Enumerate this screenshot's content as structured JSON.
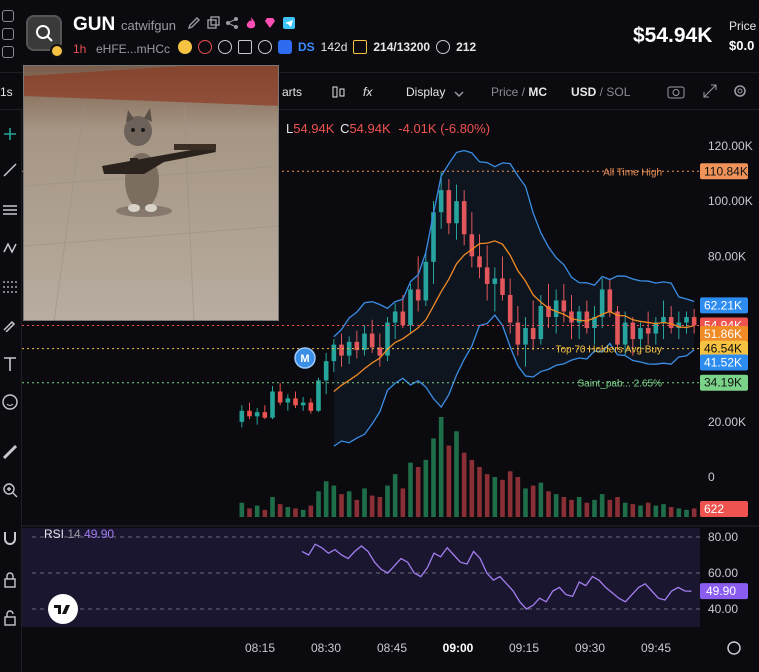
{
  "header": {
    "token_symbol": "GUN",
    "token_name": "catwifgun",
    "timeframe": "1h",
    "address": "eHFE...mHCc",
    "ds_label": "DS",
    "ds_age": "142d",
    "holders": "214/13200",
    "views": "212",
    "price": "$54.94K",
    "price_label": "Price",
    "price_sub": "$0.0"
  },
  "toolbar": {
    "charts_label": "arts",
    "display_label": "Display",
    "price_mc_price": "Price",
    "price_mc_sep": " / ",
    "price_mc_mc": "MC",
    "usd": "USD",
    "usd_sep": " / ",
    "sol": "SOL",
    "fx_label": "fx"
  },
  "ohlc": {
    "l_label": "L",
    "l_value": "54.94K",
    "c_label": "C",
    "c_value": "54.94K",
    "change": "-4.01K (-6.80%)"
  },
  "colors": {
    "up": "#26a69a",
    "down": "#ef5350",
    "bollinger": "#3a8ee6",
    "ma": "#f08a24",
    "rsi": "#a27ef0",
    "ath": "#f0935a",
    "top_holders": "#f5c242",
    "saint": "#7bd389"
  },
  "chart_data": {
    "type": "candlestick",
    "x_ticks": [
      "08:15",
      "08:30",
      "08:45",
      "09:00",
      "09:15",
      "09:30",
      "09:45"
    ],
    "y_ticks": [
      "120.00K",
      "100.00K",
      "80.00K",
      "20.00K",
      "0"
    ],
    "y_ticks_hidden_positions": [
      120000,
      100000,
      80000,
      20000,
      0
    ],
    "ylim": [
      0,
      130000
    ],
    "price_labels": [
      {
        "text": "110.84K",
        "value": 110840,
        "bg": "#f0935a",
        "fg": "#111"
      },
      {
        "text": "62.21K",
        "value": 62210,
        "bg": "#2d8cf0",
        "fg": "#fff"
      },
      {
        "text": "54.94K",
        "value": 54940,
        "bg": "#ef5350",
        "fg": "#fff"
      },
      {
        "text": "51.86K",
        "value": 51860,
        "bg": "#f08a24",
        "fg": "#fff"
      },
      {
        "text": "46.54K",
        "value": 46540,
        "bg": "#f5c242",
        "fg": "#111"
      },
      {
        "text": "41.52K",
        "value": 41520,
        "bg": "#2d8cf0",
        "fg": "#fff"
      },
      {
        "text": "34.19K",
        "value": 34190,
        "bg": "#7bd389",
        "fg": "#111"
      },
      {
        "text": "622",
        "value": 0,
        "bg": "#ef5350",
        "fg": "#fff"
      }
    ],
    "annotations": [
      {
        "text": "All Time High",
        "value": 110840
      },
      {
        "text": "Top 70 Holders Avg Buy",
        "value": 46540
      },
      {
        "text": "Saint_pab... 2.65%",
        "value": 34190
      }
    ],
    "marker_label": "M",
    "candles": [
      [
        20000,
        26000,
        18000,
        24000
      ],
      [
        24000,
        27000,
        21000,
        22000
      ],
      [
        22000,
        25000,
        19000,
        23500
      ],
      [
        23500,
        26000,
        21000,
        21500
      ],
      [
        21500,
        33000,
        21000,
        31000
      ],
      [
        31000,
        34000,
        26000,
        27000
      ],
      [
        27000,
        30000,
        24000,
        28500
      ],
      [
        28500,
        31000,
        25000,
        26000
      ],
      [
        26000,
        29000,
        24000,
        27000
      ],
      [
        27000,
        28500,
        23000,
        24000
      ],
      [
        24000,
        36000,
        23500,
        35000
      ],
      [
        35000,
        45000,
        30000,
        42000
      ],
      [
        42000,
        50000,
        38000,
        48000
      ],
      [
        48000,
        52000,
        40000,
        44000
      ],
      [
        44000,
        51000,
        41000,
        49000
      ],
      [
        49000,
        53000,
        43000,
        46000
      ],
      [
        46000,
        55000,
        44000,
        52000
      ],
      [
        52000,
        57000,
        45000,
        47000
      ],
      [
        47000,
        52000,
        40000,
        44000
      ],
      [
        44000,
        58000,
        42000,
        56000
      ],
      [
        56000,
        63000,
        50000,
        60000
      ],
      [
        60000,
        66000,
        54000,
        55000
      ],
      [
        55000,
        70000,
        52000,
        68000
      ],
      [
        68000,
        80000,
        60000,
        64000
      ],
      [
        64000,
        82000,
        62000,
        78000
      ],
      [
        78000,
        100000,
        70000,
        96000
      ],
      [
        96000,
        110800,
        90000,
        104000
      ],
      [
        104000,
        108000,
        88000,
        92000
      ],
      [
        92000,
        106000,
        86000,
        100000
      ],
      [
        100000,
        104000,
        84000,
        88000
      ],
      [
        88000,
        96000,
        76000,
        80000
      ],
      [
        80000,
        88000,
        72000,
        76000
      ],
      [
        76000,
        84000,
        64000,
        70000
      ],
      [
        70000,
        76000,
        60000,
        72000
      ],
      [
        72000,
        80000,
        64000,
        66000
      ],
      [
        66000,
        72000,
        52000,
        56000
      ],
      [
        56000,
        62000,
        44000,
        48000
      ],
      [
        48000,
        58000,
        40000,
        54000
      ],
      [
        54000,
        64000,
        46000,
        50000
      ],
      [
        50000,
        66000,
        48000,
        62000
      ],
      [
        62000,
        70000,
        54000,
        58000
      ],
      [
        58000,
        68000,
        52000,
        64000
      ],
      [
        64000,
        70000,
        56000,
        60000
      ],
      [
        60000,
        66000,
        50000,
        56000
      ],
      [
        56000,
        62000,
        50000,
        60000
      ],
      [
        60000,
        64000,
        52000,
        54000
      ],
      [
        54000,
        62000,
        48000,
        58000
      ],
      [
        58000,
        72000,
        54000,
        68000
      ],
      [
        68000,
        72000,
        58000,
        60000
      ],
      [
        60000,
        62000,
        46000,
        48000
      ],
      [
        48000,
        60000,
        44000,
        56000
      ],
      [
        56000,
        58000,
        44000,
        50000
      ],
      [
        50000,
        56000,
        46000,
        54000
      ],
      [
        54000,
        60000,
        48000,
        52000
      ],
      [
        52000,
        58000,
        48000,
        56000
      ],
      [
        56000,
        64000,
        50000,
        58000
      ],
      [
        58000,
        62000,
        52000,
        54000
      ],
      [
        54000,
        60000,
        50000,
        56000
      ],
      [
        56000,
        60000,
        52000,
        58000
      ],
      [
        58000,
        61000,
        52000,
        54940
      ]
    ],
    "volumes": [
      10,
      6,
      8,
      5,
      14,
      9,
      7,
      6,
      5,
      8,
      18,
      25,
      22,
      16,
      18,
      12,
      20,
      15,
      14,
      22,
      30,
      20,
      38,
      35,
      40,
      55,
      70,
      50,
      60,
      45,
      40,
      35,
      30,
      28,
      26,
      32,
      28,
      20,
      22,
      24,
      18,
      16,
      14,
      12,
      14,
      10,
      12,
      16,
      12,
      14,
      10,
      9,
      8,
      10,
      8,
      9,
      7,
      6,
      5,
      6
    ],
    "rsi": {
      "label": "RSI",
      "period": "14",
      "value": "49.90",
      "y_ticks": [
        "80.00",
        "60.00",
        "40.00"
      ],
      "ylim": [
        30,
        85
      ],
      "values": [
        72,
        70,
        76,
        74,
        71,
        73,
        70,
        68,
        72,
        75,
        72,
        66,
        62,
        60,
        64,
        68,
        66,
        60,
        58,
        63,
        71,
        69,
        74,
        70,
        66,
        65,
        72,
        68,
        60,
        56,
        58,
        54,
        50,
        44,
        40,
        42,
        46,
        44,
        50,
        52,
        48,
        47,
        55,
        53,
        58,
        56,
        52,
        49,
        46,
        44,
        48,
        52,
        54,
        50,
        46,
        45,
        50,
        52,
        50,
        49.9
      ],
      "value_label_bg": "#8a5cf0"
    }
  }
}
